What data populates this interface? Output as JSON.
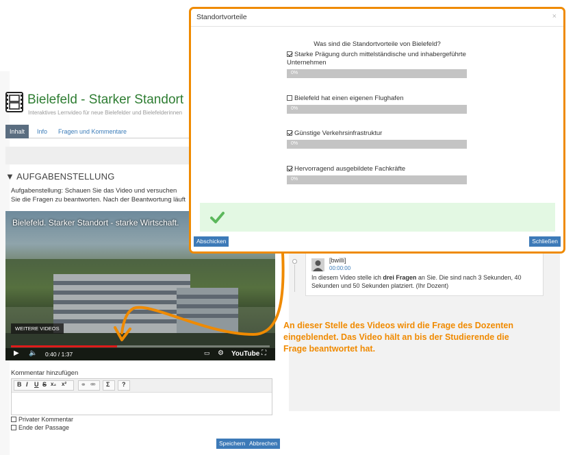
{
  "app": {
    "title": "Bielefeld - Starker Standort",
    "subtitle": "Interaktives Lernvideo für neue Bielefelder und Bielefelderinnen"
  },
  "tabs": [
    "Inhalt",
    "Info",
    "Fragen und Kommentare"
  ],
  "task": {
    "header": "▼ AUFGABENSTELLUNG",
    "text": "Aufgabenstellung: Schauen Sie das Video und versuchen Sie die Fragen zu beantworten. Nach der Beantwortung läuft das Video weiter."
  },
  "video": {
    "title": "Bielefeld. Starker Standort - starke Wirtschaft.",
    "more_videos": "WEITERE VIDEOS",
    "time": "0:40 / 1:37",
    "brand": "YouTube",
    "progress": 0.41
  },
  "editor": {
    "label": "Kommentar hinzufügen",
    "toolbar": [
      "B",
      "I",
      "U",
      "S",
      "x₂",
      "x²",
      "Σ",
      "?"
    ]
  },
  "options_checkboxes": {
    "private": "Privater Kommentar",
    "passage_end": "Ende der Passage"
  },
  "buttons": {
    "save": "Speichern",
    "cancel": "Abbrechen",
    "submit": "Abschicken",
    "close": "Schließen"
  },
  "comment": {
    "user": "[bwilli]",
    "time": "00:00:00",
    "text_before": "In diesem Video stelle ich ",
    "text_bold": "drei Fragen",
    "text_after": " an Sie. Die sind nach 3 Sekunden, 40 Sekunden und 50 Sekunden platziert. (Ihr Dozent)"
  },
  "annotation": "An dieser Stelle des Videos wird die Frage des Dozenten eingeblendet. Das Video hält an bis der Studierende die Frage beantwortet hat.",
  "modal": {
    "title": "Standortvorteile",
    "close_glyph": "×",
    "question": "Was sind die Standortvorteile von Bielefeld?",
    "options": [
      {
        "label": "Starke Prägung durch mittelständische und inhabergeführte Unternehmen",
        "checked": true,
        "percent": "0%",
        "value": 0
      },
      {
        "label": "Bielefeld hat einen eigenen Flughafen",
        "checked": false,
        "percent": "0%",
        "value": 0
      },
      {
        "label": "Günstige Verkehrsinfrastruktur",
        "checked": true,
        "percent": "0%",
        "value": 0
      },
      {
        "label": "Hervorragend ausgebildete Fachkräfte",
        "checked": true,
        "percent": "0%",
        "value": 0
      }
    ]
  },
  "colors": {
    "accent_orange": "#ef8a00",
    "button_blue": "#3d7ab8",
    "title_green": "#2e7d32",
    "success_bg": "#e3f8e3",
    "progress_red": "#e01b1b"
  },
  "icons": {
    "app": "film-icon",
    "success": "check-icon",
    "play": "play-icon",
    "volume": "volume-icon",
    "settings": "gear-icon",
    "fullscreen": "fullscreen-icon",
    "avatar": "user-avatar-icon"
  }
}
